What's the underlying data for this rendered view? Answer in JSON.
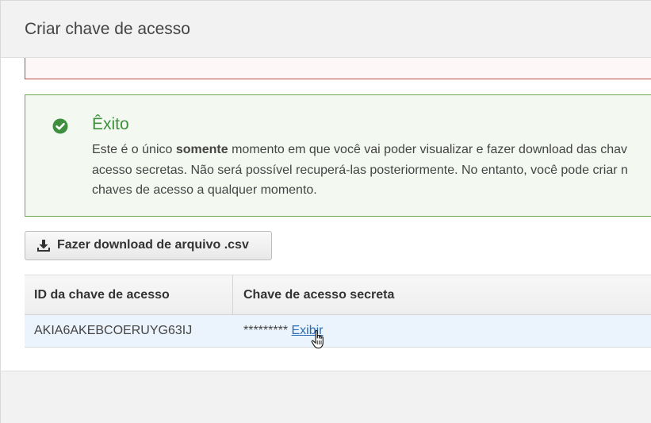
{
  "modal": {
    "title": "Criar chave de acesso"
  },
  "success_alert": {
    "icon": "check-circle-icon",
    "heading": "Êxito",
    "line1_prefix": "Este é o único ",
    "line1_bold": "somente",
    "line1_suffix": " momento em que você vai poder visualizar e fazer download das chav",
    "line2": "acesso secretas. Não será possível recuperá-las posteriormente. No entanto, você pode criar n",
    "line3": "chaves de acesso a qualquer momento.",
    "color": "#3e8f3e"
  },
  "download_button": {
    "icon": "download-icon",
    "label": "Fazer download de arquivo .csv"
  },
  "table": {
    "headers": [
      "ID da chave de acesso",
      "Chave de acesso secreta"
    ],
    "rows": [
      {
        "access_key_id": "AKIA6AKEBCOERUYG63IJ",
        "secret_mask": "*********",
        "show_link": "Exibir"
      }
    ]
  },
  "colors": {
    "error_border": "#b94a48",
    "success_border": "#6aa84f",
    "link": "#2a6bb8",
    "row_highlight": "#ebf3fc"
  }
}
